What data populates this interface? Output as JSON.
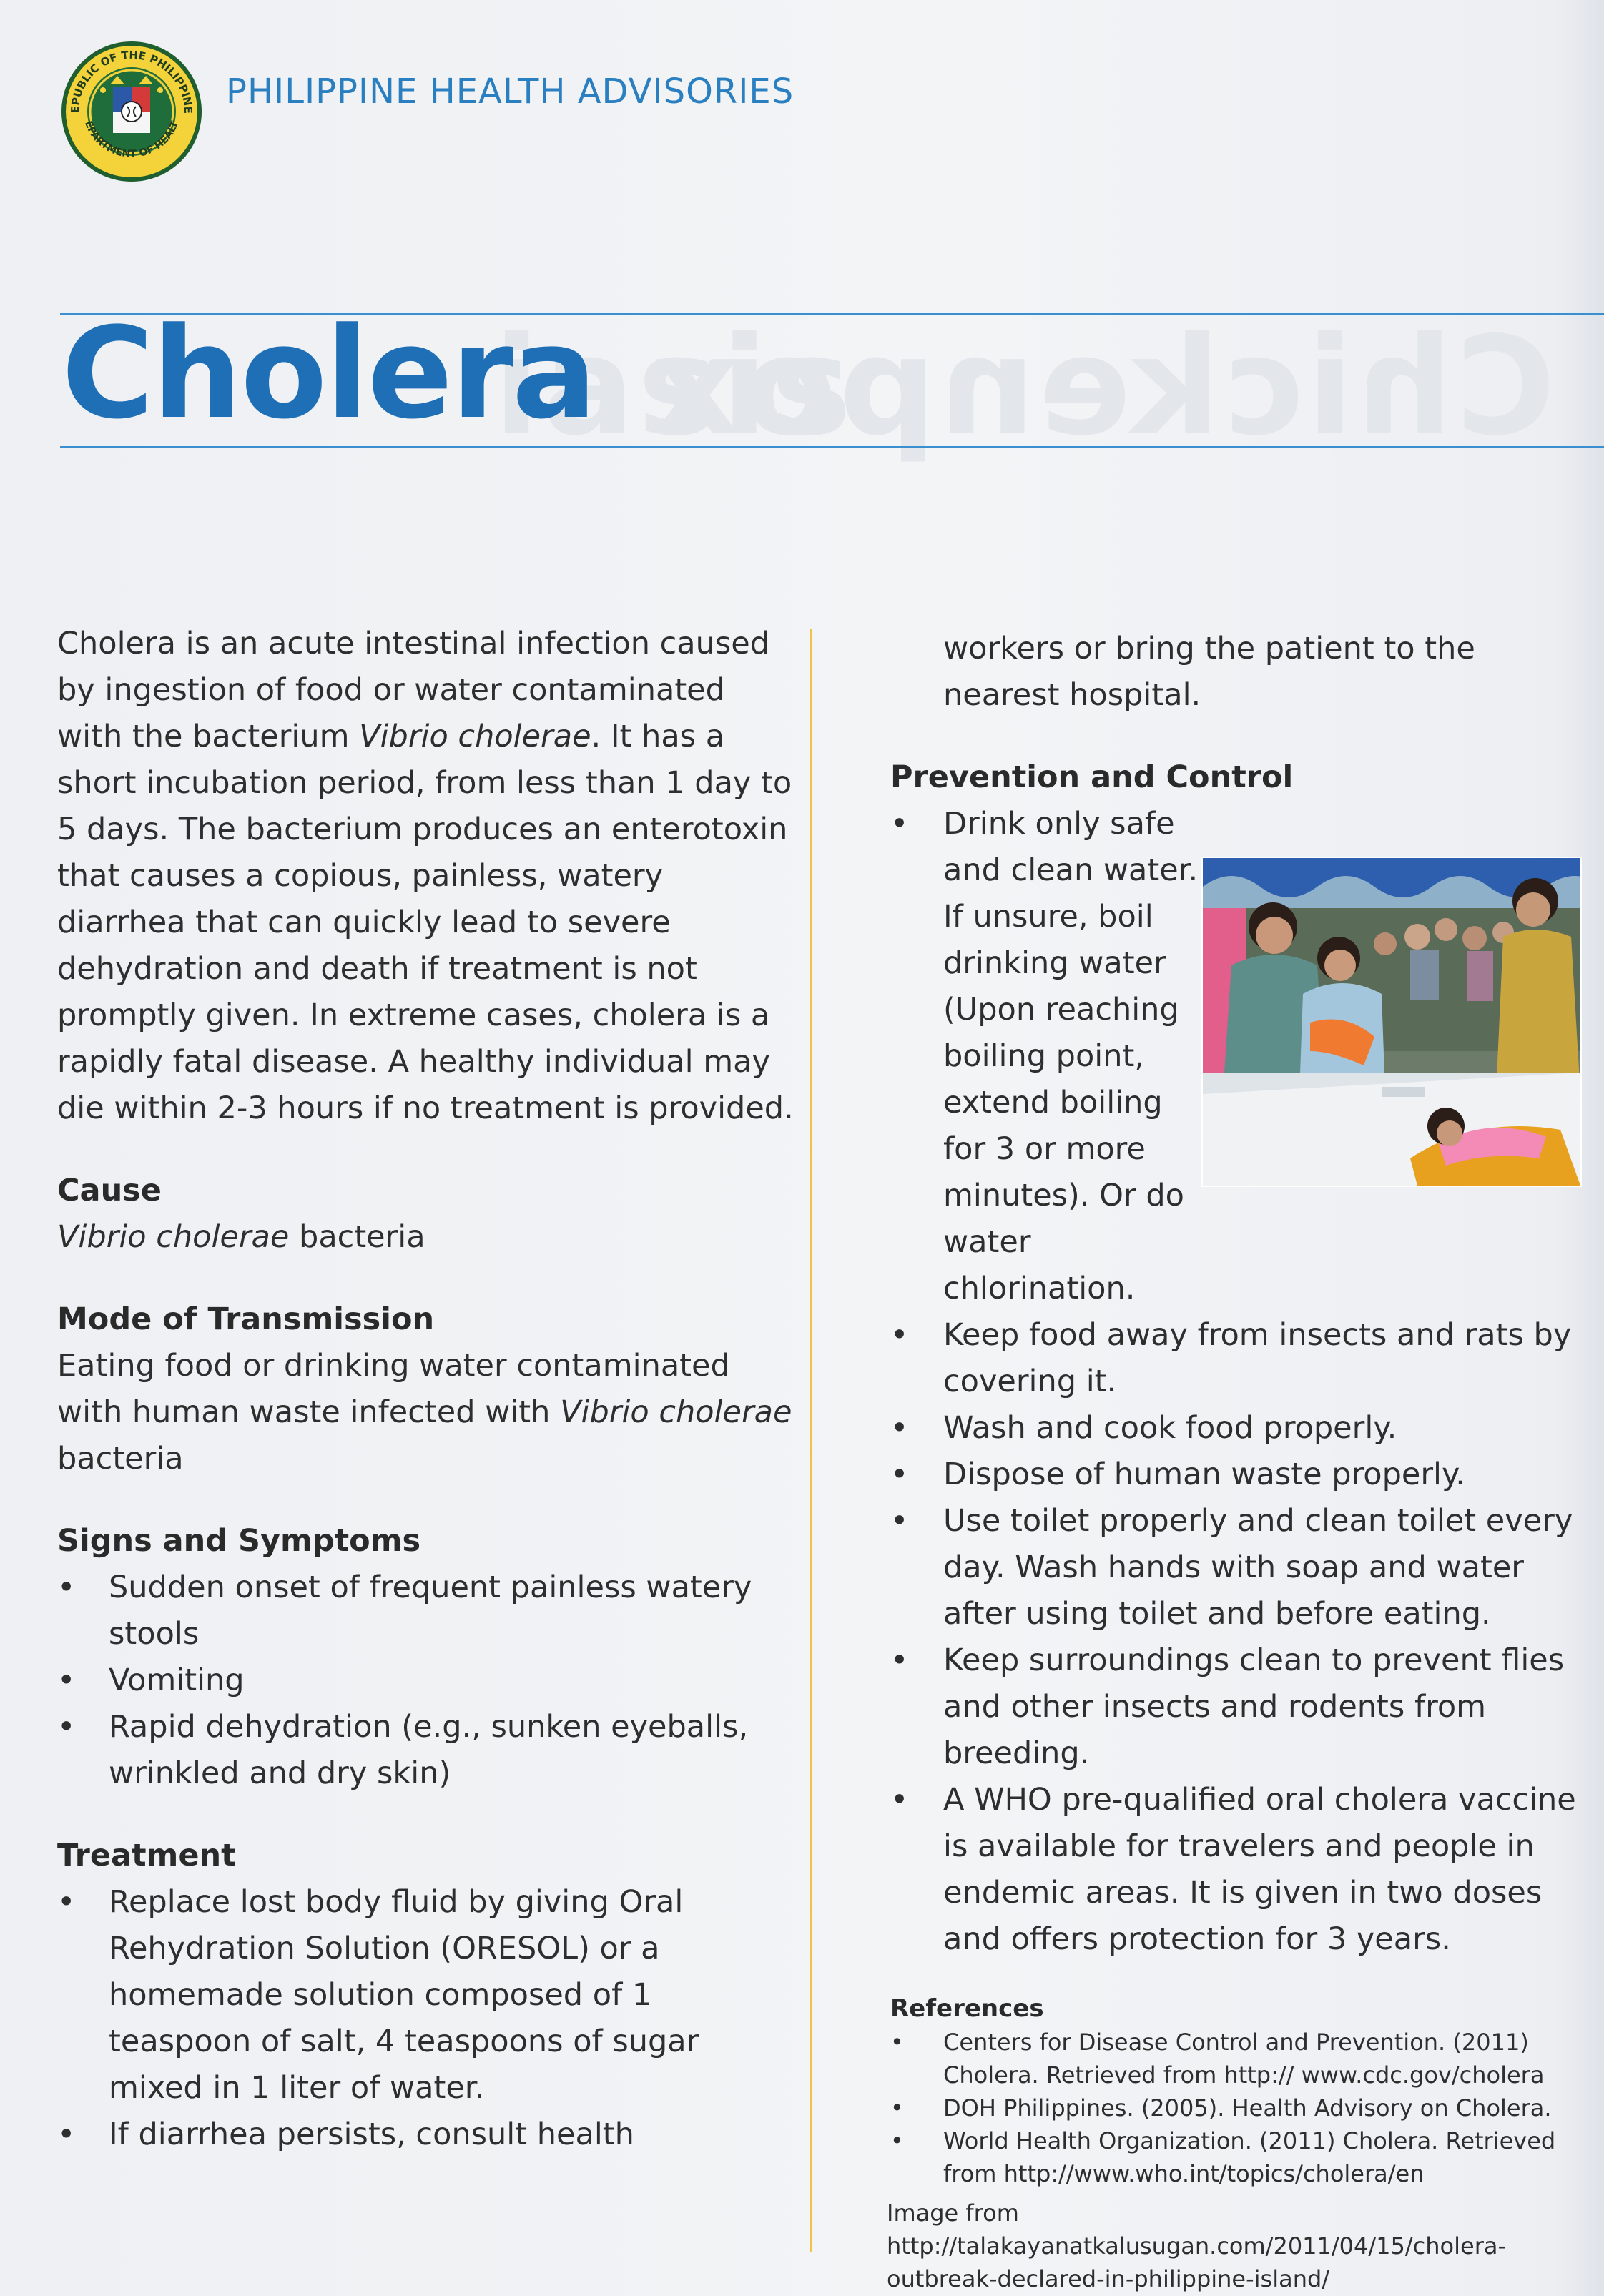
{
  "header": {
    "agency": "PHILIPPINE HEALTH ADVISORIES",
    "seal_text_top": "REPUBLIC OF THE PHILIPPINES",
    "seal_text_bottom": "DEPARTMENT OF HEALTH"
  },
  "title": "Cholera",
  "ghost_titles": [
    "iasis",
    "Chickenpox"
  ],
  "intro_parts": [
    "Cholera is an acute intestinal infection caused by ingestion of food or water contaminated with the bacterium ",
    "Vibrio cholerae",
    ". It has a short incubation period, from less than 1 day to 5 days. The bacterium produces an enterotoxin that causes a copious, painless, watery diarrhea that can quickly lead to severe dehydration and death if treatment is not promptly given. In extreme cases, cholera is a rapidly fatal disease. A healthy individual may die within 2-3 hours if no treatment is provided."
  ],
  "cause": {
    "heading": "Cause",
    "organism": "Vibrio cholerae",
    "suffix": " bacteria"
  },
  "transmission": {
    "heading": "Mode of Transmission",
    "text_before": "Eating food or drinking water contaminated with human waste infected with ",
    "organism": "Vibrio cholerae",
    "suffix": " bacteria"
  },
  "symptoms": {
    "heading": "Signs and Symptoms",
    "items": [
      "Sudden onset of frequent painless watery stools",
      "Vomiting",
      "Rapid dehydration (e.g., sunken eyeballs, wrinkled and dry skin)"
    ]
  },
  "treatment": {
    "heading": "Treatment",
    "items": [
      "Replace lost body fluid by giving Oral Rehydration Solution (ORESOL) or a homemade solution composed of 1 teaspoon of salt, 4 teaspoons of sugar mixed in 1 liter of water.",
      "If diarrhea persists, consult health"
    ],
    "continuation": "workers or bring the patient to the nearest hospital."
  },
  "prevention": {
    "heading": "Prevention and Control",
    "first_item": "Drink only safe and clean water. If unsure, boil drinking water (Upon reaching boiling point, extend boiling for 3 or more minutes). Or do water chlorination.",
    "items": [
      "Keep food away from insects and rats by covering it.",
      "Wash and cook food properly.",
      "Dispose of human waste properly.",
      "Use toilet properly and clean toilet every day. Wash hands with soap and water after using toilet and before eating.",
      "Keep surroundings clean to prevent flies and other insects and rodents from breeding.",
      "A WHO pre-qualified oral cholera vaccine is available for travelers and people in endemic areas. It is given in two doses and offers protection for 3 years."
    ]
  },
  "references": {
    "heading": "References",
    "items": [
      "Centers for Disease Control and Prevention. (2011) Cholera. Retrieved from  http:// www.cdc.gov/cholera",
      "DOH Philippines. (2005). Health Advisory on Cholera.",
      "World Health Organization. (2011) Cholera. Retrieved from http://www.who.int/topics/cholera/en"
    ]
  },
  "image_credit": "Image from http://talakayanatkalusugan.com/2011/04/15/cholera-outbreak-declared-in-philippine-island/",
  "colors": {
    "brand_blue": "#1f6fb6",
    "rule_blue": "#3b8fd0",
    "divider_yellow": "#f0c24a"
  }
}
